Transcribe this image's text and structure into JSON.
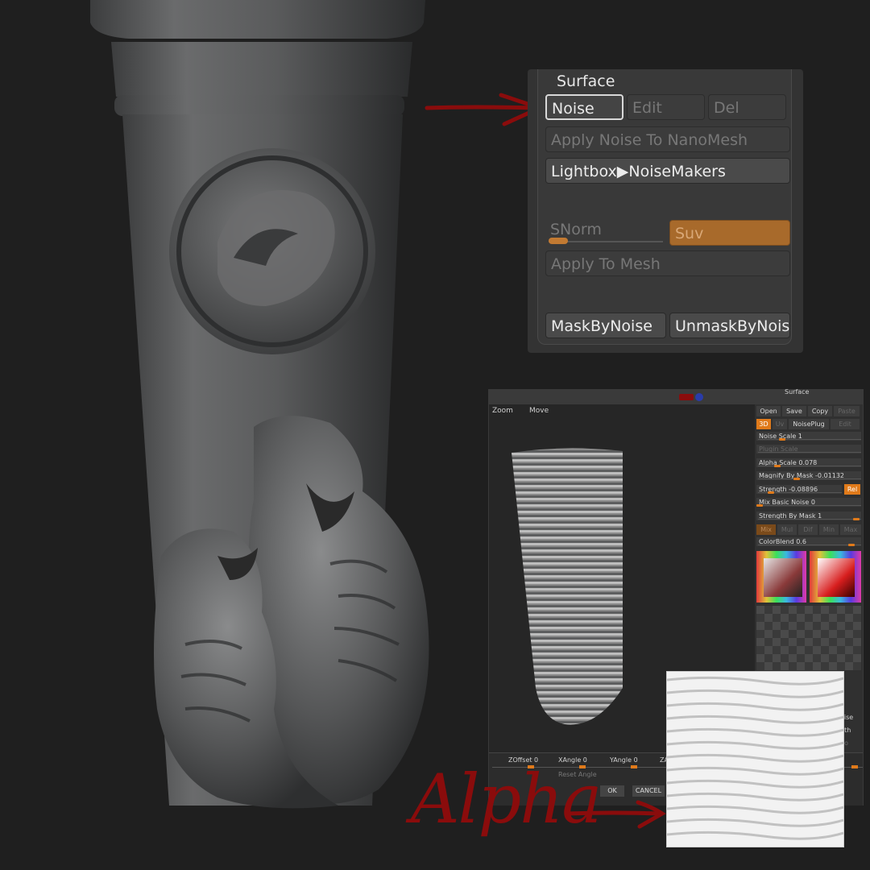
{
  "surface_panel": {
    "title": "Surface",
    "noise": "Noise",
    "edit": "Edit",
    "del": "Del",
    "apply_noise_nanomesh": "Apply Noise To NanoMesh",
    "lightbox_noisemakers": "Lightbox▶NoiseMakers",
    "snorm": "SNorm",
    "suv": "Suv",
    "apply_to_mesh": "Apply To Mesh",
    "mask_by_noise": "MaskByNoise",
    "unmask_by_noise": "UnmaskByNoise"
  },
  "noise_window": {
    "header_title": "Surface",
    "zoom": "Zoom",
    "move": "Move",
    "buttons": {
      "open": "Open",
      "save": "Save",
      "copy": "Copy",
      "paste": "Paste"
    },
    "tabs": {
      "three_d": "3D",
      "uv": "Uv",
      "noiseplug": "NoisePlug",
      "edit": "Edit"
    },
    "noise_scale": "Noise Scale  1",
    "plugin_scale": "Plugin Scale",
    "alpha_scale": "Alpha Scale  0.078",
    "magnify_by_mask": "Magnify By Mask -0.01132",
    "strength": "Strength -0.08896",
    "rel": "Rel",
    "mix_basic_noise": "Mix Basic Noise 0",
    "strength_by_mask": "Strength By Mask 1",
    "blend_modes": [
      "Mix",
      "Mul",
      "Dif",
      "Min",
      "Max"
    ],
    "color_blend": "ColorBlend 0.6",
    "zoffset": "ZOffset 0",
    "xangle": "XAngle 0",
    "yangle": "YAngle 0",
    "zangle_partial": "ZA",
    "reset_angle": "Reset Angle",
    "ok": "OK",
    "cancel": "CANCEL",
    "cut_right_1": "oise",
    "cut_right_2": "gth",
    "cut_right_3": "do"
  },
  "annotation": {
    "alpha_label": "Alpha",
    "ink_color": "#8a0c0c"
  }
}
